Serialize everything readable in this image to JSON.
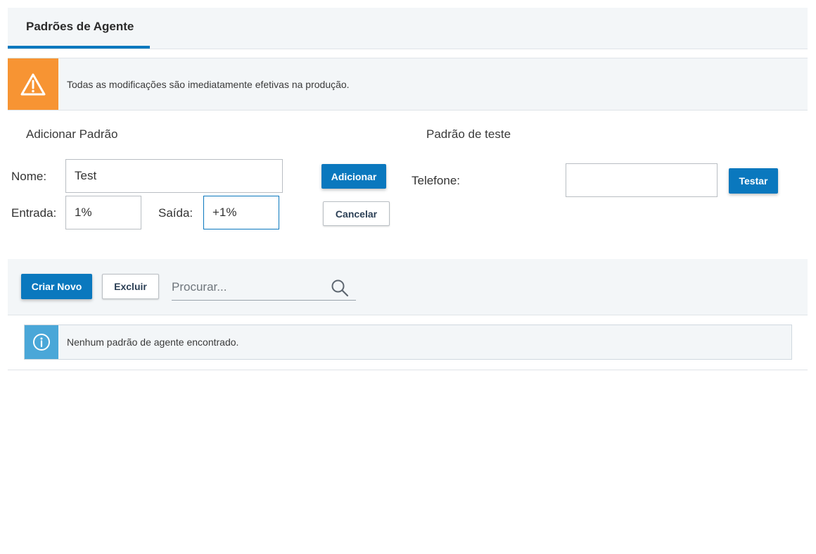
{
  "tabs": [
    {
      "label": "Padrões de Agente"
    }
  ],
  "warning": {
    "text": "Todas as modificações são imediatamente efetivas na produção."
  },
  "add_pattern": {
    "title": "Adicionar Padrão",
    "name_label": "Nome:",
    "name_value": "Test",
    "input_label": "Entrada:",
    "input_value": "1%",
    "output_label": "Saída:",
    "output_value": "+1%",
    "add_button": "Adicionar",
    "cancel_button": "Cancelar"
  },
  "test_pattern": {
    "title": "Padrão de teste",
    "phone_label": "Telefone:",
    "phone_value": "",
    "test_button": "Testar"
  },
  "toolbar": {
    "create_button": "Criar Novo",
    "delete_button": "Excluir",
    "search_placeholder": "Procurar..."
  },
  "info": {
    "text": "Nenhum padrão de agente encontrado."
  },
  "colors": {
    "accent": "#0a78be",
    "warning": "#f79433",
    "info": "#4aa7d8",
    "panel": "#f3f6f8"
  },
  "icons": {
    "warning": "warning-icon",
    "search": "search-icon",
    "info": "info-icon"
  }
}
